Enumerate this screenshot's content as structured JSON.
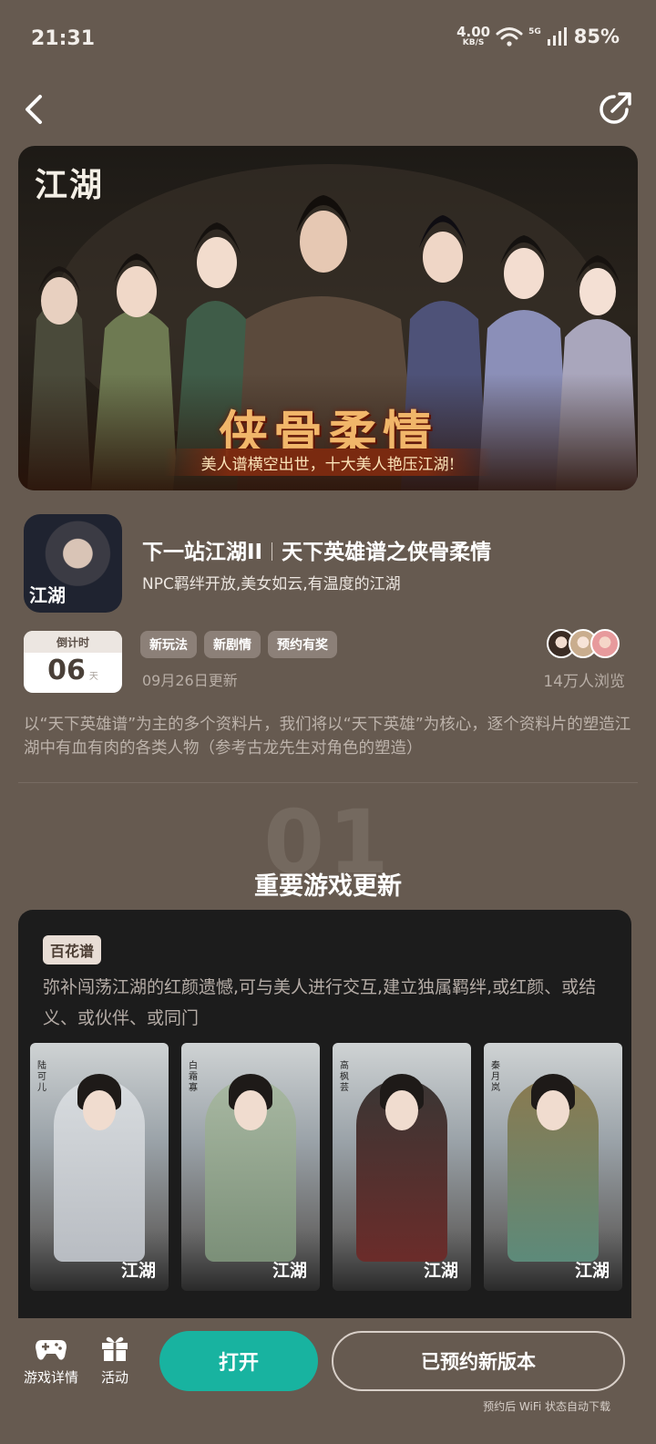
{
  "status_bar": {
    "time": "21:31",
    "net_speed_value": "4.00",
    "net_speed_unit": "KB/S",
    "signal_label": "5G",
    "battery": "85%"
  },
  "banner": {
    "logo_text": "江湖",
    "headline": "侠骨柔情",
    "tagline": "美人谱横空出世，十大美人艳压江湖!"
  },
  "app": {
    "icon_text": "江湖",
    "title_part1": "下一站江湖II",
    "title_part2": "天下英雄谱之侠骨柔情",
    "subtitle": "NPC羁绊开放,美女如云,有温度的江湖",
    "countdown_label": "倒计时",
    "countdown_value": "06",
    "countdown_unit": "天",
    "tags": [
      "新玩法",
      "新剧情",
      "预约有奖"
    ],
    "update_date": "09月26日更新",
    "views": "14万人浏览",
    "description": "以“天下英雄谱”为主的多个资料片，我们将以“天下英雄”为核心，逐个资料片的塑造江湖中有血有肉的各类人物（参考古龙先生对角色的塑造）"
  },
  "section": {
    "number": "01",
    "title": "重要游戏更新"
  },
  "update_card": {
    "tag": "百花谱",
    "text": "弥补闯荡江湖的红颜遗憾,可与美人进行交互,建立独属羁绊,或红颜、或结义、或伙伴、或同门",
    "heroes": [
      {
        "name": "陆可儿",
        "logo": "江湖"
      },
      {
        "name": "白霜寡",
        "logo": "江湖"
      },
      {
        "name": "高枫芸",
        "logo": "江湖"
      },
      {
        "name": "秦月岚",
        "logo": "江湖"
      }
    ]
  },
  "bottom_bar": {
    "details_label": "游戏详情",
    "activity_label": "活动",
    "open_label": "打开",
    "reserved_label": "已预约新版本",
    "wifi_note": "预约后 WiFi 状态自动下载"
  },
  "colors": {
    "background": "#665a50",
    "accent": "#18b3a0",
    "card": "#1c1c1c"
  }
}
